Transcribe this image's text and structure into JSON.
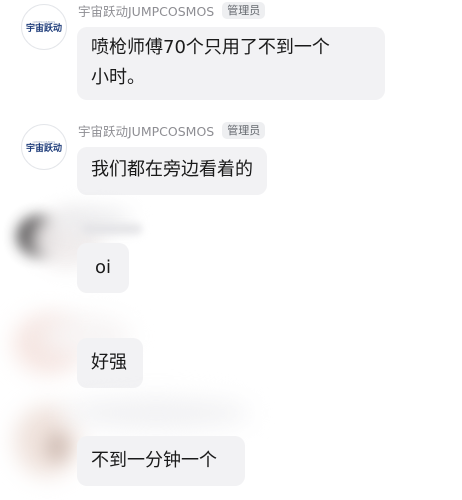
{
  "messages": [
    {
      "sender": "宇宙跃动JUMPCOSMOS",
      "role": "管理员",
      "avatar_text": "宇宙跃动",
      "avatar_top": "JUMPCOSMOS",
      "text_lines": [
        "喷枪师傅70个只用了不到一个",
        "小时。"
      ]
    },
    {
      "sender": "宇宙跃动JUMPCOSMOS",
      "role": "管理员",
      "avatar_text": "宇宙跃动",
      "avatar_top": "JUMPCOSMOS",
      "text": "我们都在旁边看着的"
    },
    {
      "text": "oi"
    },
    {
      "text": "好强"
    },
    {
      "text": "不到一分钟一个"
    }
  ]
}
